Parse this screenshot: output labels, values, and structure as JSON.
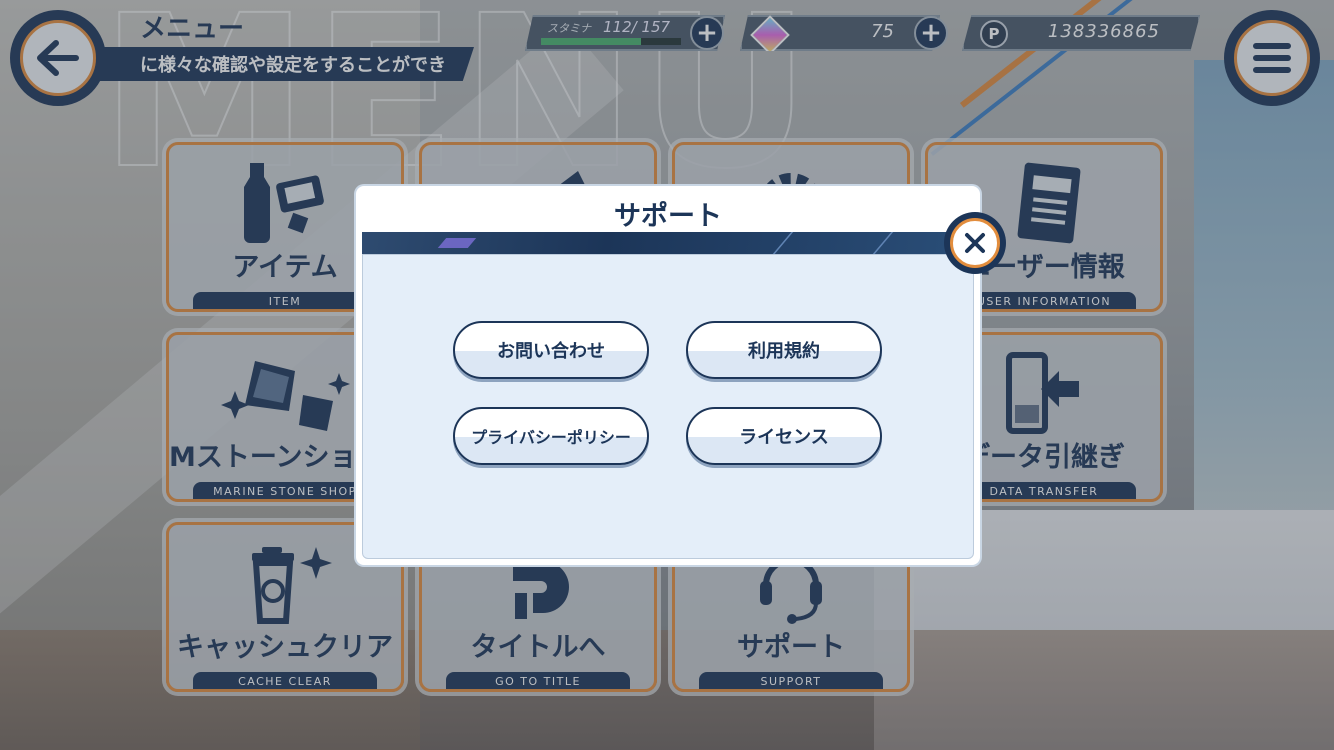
{
  "header": {
    "title": "メニュー",
    "subtitle": "に様々な確認や設定をすることができ",
    "stamina_label": "スタミナ",
    "stamina_value": "112/ 157",
    "stamina_fraction": 0.713,
    "gems_value": "75",
    "points_icon_letter": "P",
    "points_value": "138336865"
  },
  "tiles": [
    {
      "jp": "アイテム",
      "en": "ITEM"
    },
    {
      "jp": "Mストーンショップ",
      "en": "MARINE STONE SHOP"
    },
    {
      "jp": "キャッシュクリア",
      "en": "CACHE CLEAR"
    },
    {
      "jp": "タイトルへ",
      "en": "GO TO TITLE"
    },
    {
      "jp": "サポート",
      "en": "SUPPORT"
    },
    {
      "jp": "ユーザー情報",
      "en": "USER INFORMATION"
    },
    {
      "jp": "データ引継ぎ",
      "en": "DATA TRANSFER"
    }
  ],
  "modal": {
    "title": "サポート",
    "buttons": [
      "お問い合わせ",
      "利用規約",
      "プライバシーポリシー",
      "ライセンス"
    ]
  },
  "colors": {
    "navy": "#1c3558",
    "orange": "#e28d3d",
    "stamina_green": "#49b06d"
  }
}
